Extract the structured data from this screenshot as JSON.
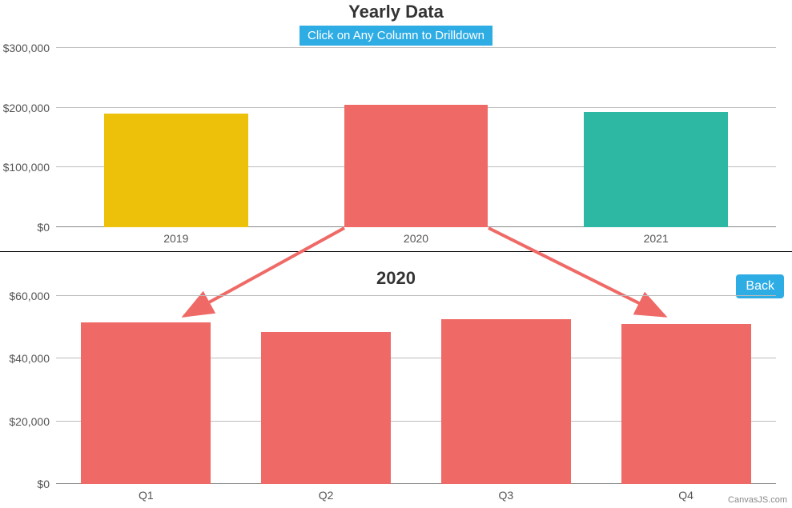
{
  "top": {
    "title": "Yearly Data",
    "subtitle": "Click on Any Column to Drilldown",
    "yticks": [
      "$0",
      "$100,000",
      "$200,000",
      "$300,000"
    ],
    "bars": [
      {
        "label": "2019",
        "value": 190000,
        "color": "#edc109"
      },
      {
        "label": "2020",
        "value": 205000,
        "color": "#ef6a66"
      },
      {
        "label": "2021",
        "value": 193000,
        "color": "#2cb8a3"
      }
    ]
  },
  "bottom": {
    "title": "2020",
    "back": "Back",
    "yticks": [
      "$0",
      "$20,000",
      "$40,000",
      "$60,000"
    ],
    "bars": [
      {
        "label": "Q1",
        "value": 51500,
        "color": "#ef6a66"
      },
      {
        "label": "Q2",
        "value": 48500,
        "color": "#ef6a66"
      },
      {
        "label": "Q3",
        "value": 52500,
        "color": "#ef6a66"
      },
      {
        "label": "Q4",
        "value": 51000,
        "color": "#ef6a66"
      }
    ],
    "credit": "CanvasJS.com"
  },
  "chart_data": [
    {
      "type": "bar",
      "title": "Yearly Data",
      "subtitle": "Click on Any Column to Drilldown",
      "categories": [
        "2019",
        "2020",
        "2021"
      ],
      "values": [
        190000,
        205000,
        193000
      ],
      "colors": [
        "#edc109",
        "#ef6a66",
        "#2cb8a3"
      ],
      "ylabel": "",
      "xlabel": "",
      "ylim": [
        0,
        300000
      ]
    },
    {
      "type": "bar",
      "title": "2020",
      "categories": [
        "Q1",
        "Q2",
        "Q3",
        "Q4"
      ],
      "values": [
        51500,
        48500,
        52500,
        51000
      ],
      "colors": [
        "#ef6a66",
        "#ef6a66",
        "#ef6a66",
        "#ef6a66"
      ],
      "ylabel": "",
      "xlabel": "",
      "ylim": [
        0,
        60000
      ]
    }
  ]
}
